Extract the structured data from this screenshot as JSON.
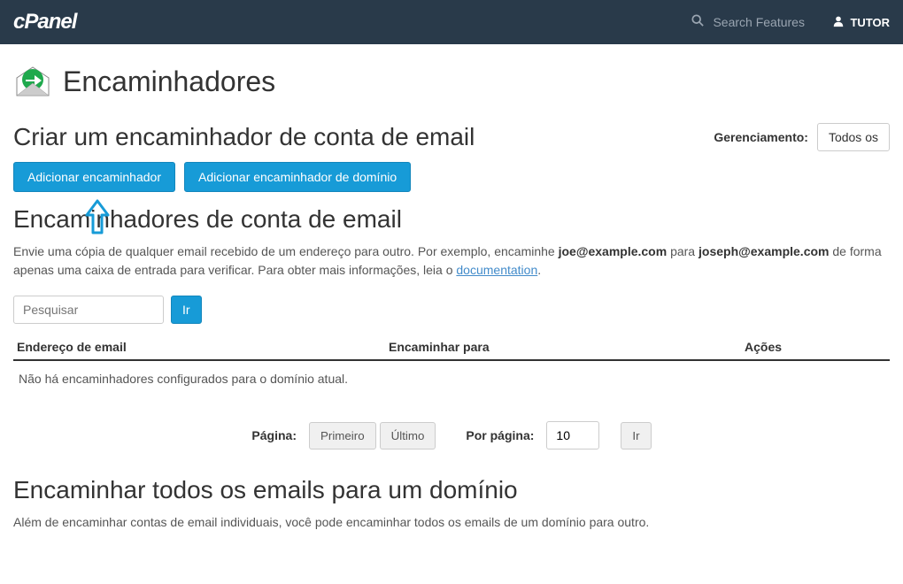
{
  "header": {
    "logo": "cPanel",
    "search_placeholder": "Search Features",
    "user_label": "TUTOR"
  },
  "page": {
    "title": "Encaminhadores"
  },
  "section1": {
    "heading": "Criar um encaminhador de conta de email",
    "mgmt_label": "Gerenciamento:",
    "mgmt_value": "Todos os",
    "btn_add": "Adicionar encaminhador",
    "btn_add_domain": "Adicionar encaminhador de domínio"
  },
  "section2": {
    "heading": "Encaminhadores de conta de email",
    "desc_before": "Envie uma cópia de qualquer email recebido de um endereço para outro. Por exemplo, encaminhe ",
    "desc_bold1": "joe@example.com",
    "desc_mid": " para ",
    "desc_bold2": "joseph@example.com",
    "desc_after": " de forma apenas uma caixa de entrada para verificar. Para obter mais informações, leia o ",
    "desc_link": "documentation",
    "desc_end": ".",
    "search_placeholder": "Pesquisar",
    "search_btn": "Ir",
    "col_email": "Endereço de email",
    "col_fwd": "Encaminhar para",
    "col_act": "Ações",
    "empty_msg": "Não há encaminhadores configurados para o domínio atual.",
    "pager_page_label": "Página:",
    "pager_first": "Primeiro",
    "pager_last": "Último",
    "pager_perpage_label": "Por página:",
    "pager_perpage_value": "10",
    "pager_go": "Ir"
  },
  "section3": {
    "heading": "Encaminhar todos os emails para um domínio",
    "desc": "Além de encaminhar contas de email individuais, você pode encaminhar todos os emails de um domínio para outro."
  }
}
